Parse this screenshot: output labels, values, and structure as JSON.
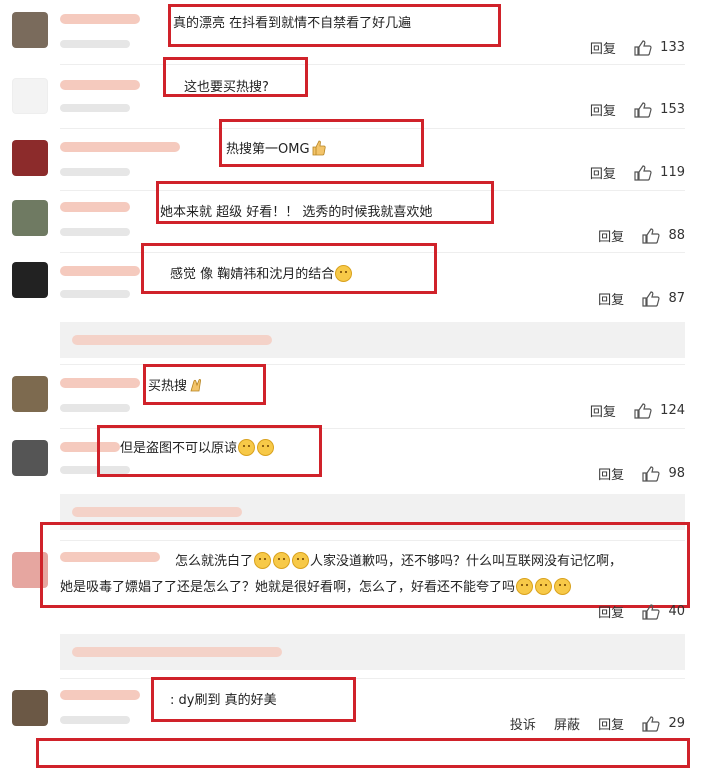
{
  "comments": [
    {
      "text": "真的漂亮 在抖看到就情不自禁看了好几遍",
      "reply": "回复",
      "likes": "133"
    },
    {
      "text": "这也要买热搜?",
      "reply": "回复",
      "likes": "153"
    },
    {
      "text": "热搜第一OMG",
      "reply": "回复",
      "likes": "119"
    },
    {
      "text": "她本来就 超级 好看！！ 选秀的时候我就喜欢她",
      "reply": "回复",
      "likes": "88"
    },
    {
      "text": "感觉 像 鞠婧祎和沈月的结合",
      "reply": "回复",
      "likes": "87"
    },
    {
      "text": "买热搜",
      "reply": "回复",
      "likes": "124"
    },
    {
      "text": "但是盗图不可以原谅",
      "reply": "回复",
      "likes": "98"
    },
    {
      "text_line1_a": "怎么就洗白了",
      "text_line1_b": "人家没道歉吗，还不够吗？什么叫互联网没有记忆啊，",
      "text_line2": "她是吸毒了嫖娼了了还是怎么了？她就是很好看啊，怎么了，好看还不能夸了吗",
      "reply": "回复",
      "likes": "40"
    },
    {
      "text": ": dy刷到 真的好美",
      "report": "投诉",
      "block": "屏蔽",
      "reply": "回复",
      "likes": "29"
    }
  ],
  "colors": {
    "highlight_border": "#d0222a",
    "subcomment_bg": "#f1f1f1"
  },
  "icons": [
    "thumbs-up-icon",
    "emoji-icon"
  ]
}
